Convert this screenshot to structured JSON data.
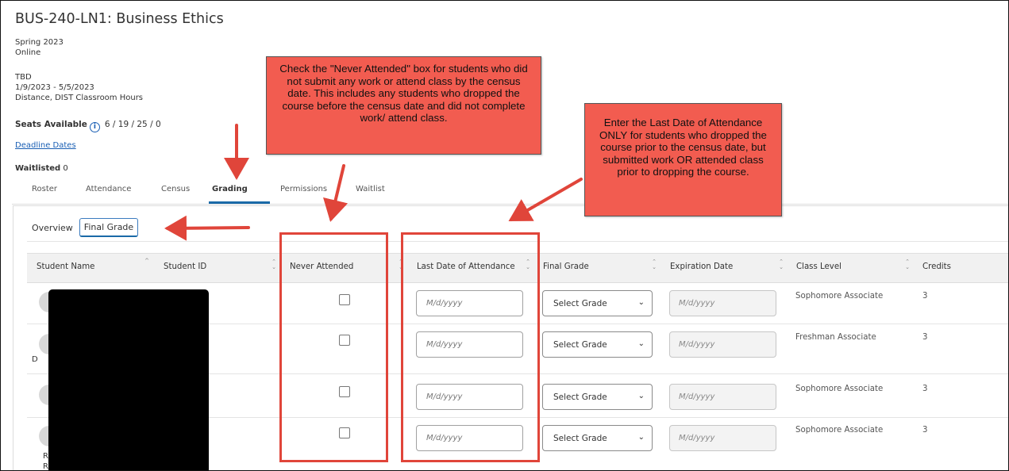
{
  "course": {
    "title": "BUS-240-LN1: Business Ethics",
    "term": "Spring 2023",
    "mode": "Online",
    "location": "TBD",
    "dates": "1/9/2023 - 5/5/2023",
    "hours": "Distance, DIST Classroom Hours",
    "seats_label": "Seats Available",
    "seats_value": "6 / 19 / 25 / 0",
    "deadline_link": "Deadline Dates",
    "waitlisted_label": "Waitlisted",
    "waitlisted_value": "0"
  },
  "tabs": [
    "Roster",
    "Attendance",
    "Census",
    "Grading",
    "Permissions",
    "Waitlist"
  ],
  "active_tab": "Grading",
  "subtabs": {
    "overview": "Overview",
    "final_grade": "Final Grade"
  },
  "table": {
    "headers": {
      "student_name": "Student Name",
      "student_id": "Student ID",
      "never_attended": "Never Attended",
      "last_date": "Last Date of Attendance",
      "final_grade": "Final Grade",
      "expiration_date": "Expiration Date",
      "class_level": "Class Level",
      "credits": "Credits"
    },
    "date_placeholder": "M/d/yyyy",
    "select_label": "Select Grade",
    "rows": [
      {
        "initial": "",
        "initial2": "",
        "class_level": "Sophomore Associate",
        "credits": "3"
      },
      {
        "initial": "D",
        "initial2": "",
        "class_level": "Freshman Associate",
        "credits": "3"
      },
      {
        "initial": "",
        "initial2": "",
        "class_level": "Sophomore Associate",
        "credits": "3"
      },
      {
        "initial": "R",
        "initial2": "R",
        "class_level": "Sophomore Associate",
        "credits": "3"
      }
    ]
  },
  "annotations": {
    "never_attended_note": "Check the \"Never Attended\" box for students who did not submit any work or attend class by the census date. This includes any students who dropped the course before the census date and did not complete work/ attend class.",
    "last_date_note": "Enter the Last Date of Attendance ONLY for students who dropped the course prior to the census date, but submitted work OR attended class prior to dropping the course."
  },
  "colors": {
    "annotation_red": "#f25c50",
    "box_red": "#e0453a",
    "link_blue": "#1a5fb4",
    "tab_underline": "#1a6aa8"
  }
}
